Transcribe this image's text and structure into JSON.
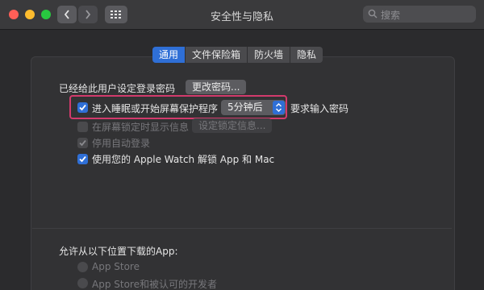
{
  "window": {
    "title": "安全性与隐私"
  },
  "search": {
    "placeholder": "搜索"
  },
  "tabs": [
    {
      "label": "通用",
      "active": true
    },
    {
      "label": "文件保险箱",
      "active": false
    },
    {
      "label": "防火墙",
      "active": false
    },
    {
      "label": "隐私",
      "active": false
    }
  ],
  "general": {
    "password_set_label": "已经给此用户设定登录密码",
    "change_password_button": "更改密码...",
    "require_password": {
      "label": "进入睡眠或开始屏幕保护程序",
      "checked": true,
      "delay_value": "5分钟后",
      "suffix": "要求输入密码"
    },
    "show_message": {
      "label": "在屏幕锁定时显示信息",
      "checked": false,
      "enabled": false,
      "button": "设定锁定信息..."
    },
    "disable_auto_login": {
      "label": "停用自动登录",
      "checked": true,
      "enabled": false
    },
    "apple_watch": {
      "label": "使用您的 Apple Watch 解锁 App 和 Mac",
      "checked": true
    }
  },
  "downloads": {
    "heading": "允许从以下位置下载的App:",
    "options": [
      {
        "label": "App Store",
        "selected": false,
        "enabled": false
      },
      {
        "label": "App Store和被认可的开发者",
        "selected": false,
        "enabled": false
      }
    ]
  },
  "colors": {
    "accent": "#2f6fd6",
    "highlight_border": "#d23a6c"
  }
}
